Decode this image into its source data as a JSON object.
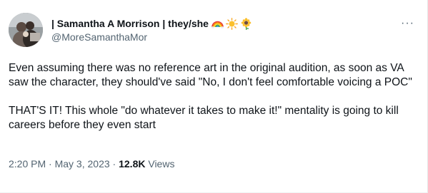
{
  "author": {
    "name": "| Samantha A Morrison | they/she",
    "handle": "@MoreSamanthaMor",
    "name_emojis": [
      "rainbow-icon",
      "sun-icon",
      "sunflower-icon"
    ]
  },
  "tweet": {
    "paragraphs": [
      "Even assuming there was no reference art in the original audition, as soon as VA saw the character, they should've said \"No, I don't feel comfortable voicing a POC\"",
      "THAT'S IT! This whole \"do whatever it takes to make it!\" mentality is going to kill careers before they even start"
    ]
  },
  "meta": {
    "time": "2:20 PM",
    "separator": " · ",
    "date": "May 3, 2023",
    "views_count": "12.8K",
    "views_label": " Views"
  },
  "more_menu": {
    "icon": "more-options-icon",
    "glyph": "···"
  },
  "colors": {
    "text": "#0f1419",
    "secondary": "#536471"
  }
}
